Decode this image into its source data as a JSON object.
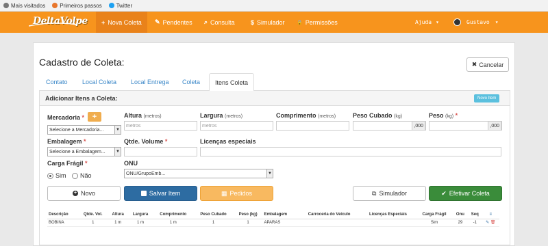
{
  "bookmarks": [
    {
      "label": "Mais visitados",
      "icon": "gear-icon"
    },
    {
      "label": "Primeiros passos",
      "icon": "firefox-icon"
    },
    {
      "label": "Twitter",
      "icon": "twitter-icon"
    }
  ],
  "navbar": {
    "brand": "DeltaVolpe",
    "items": [
      {
        "label": "Nova Coleta",
        "icon": "plus-icon",
        "glyph": "+"
      },
      {
        "label": "Pendentes",
        "icon": "edit-icon",
        "glyph": "✎"
      },
      {
        "label": "Consulta",
        "icon": "search-icon",
        "glyph": "⌕"
      },
      {
        "label": "Simulador",
        "icon": "dollar-icon",
        "glyph": "$"
      },
      {
        "label": "Permissões",
        "icon": "lock-icon",
        "glyph": "🔒"
      }
    ],
    "help_label": "Ajuda",
    "user_name": "Gustavo",
    "accent": "#f7941d"
  },
  "page": {
    "title": "Cadastro de Coleta:",
    "cancel_label": "Cancelar",
    "tabs": [
      {
        "label": "Contato"
      },
      {
        "label": "Local Coleta"
      },
      {
        "label": "Local Entrega"
      },
      {
        "label": "Coleta"
      },
      {
        "label": "Itens Coleta"
      }
    ]
  },
  "panel": {
    "title": "Adicionar Itens a Coleta:",
    "new_item_label": "Novo Item"
  },
  "form": {
    "mercadoria": {
      "label": "Mercadoria",
      "value": "Selecione a Mercadoria..."
    },
    "altura": {
      "label": "Altura",
      "unit": "(metros)",
      "placeholder": "metros"
    },
    "largura": {
      "label": "Largura",
      "unit": "(metros)",
      "placeholder": "metros"
    },
    "comprimento": {
      "label": "Comprimento",
      "unit": "(metros)",
      "value": ""
    },
    "peso_cubado": {
      "label": "Peso Cubado",
      "unit": "(kg)",
      "suffix": ",000"
    },
    "peso": {
      "label": "Peso",
      "unit": "(kg)",
      "suffix": ",000"
    },
    "embalagem": {
      "label": "Embalagem",
      "value": "Selecione a Embalagem..."
    },
    "qtde_volume": {
      "label": "Qtde. Volume",
      "value": ""
    },
    "licencas": {
      "label": "Licenças especiais",
      "value": ""
    },
    "carga_fragil": {
      "label": "Carga Frágil",
      "options": [
        "Sim",
        "Não"
      ],
      "selected": "Sim"
    },
    "onu": {
      "label": "ONU",
      "value": "ONU/GrupoEmb..."
    },
    "required_mark": "*"
  },
  "buttons": {
    "novo": "Novo",
    "salvar": "Salvar Item",
    "pedidos": "Pedidos",
    "simulador": "Simulador",
    "efetivar": "Efetivar Coleta"
  },
  "table": {
    "headers": [
      "Descrição",
      "Qtde. Vol.",
      "Altura",
      "Largura",
      "Comprimento",
      "Peso Cubado",
      "Peso (kg)",
      "Embalagem",
      "Carroceria do Veículo",
      "Licenças Especiais",
      "Carga Frágil",
      "Onu",
      "Seq",
      "≡"
    ],
    "rows": [
      [
        "BOBINA",
        "1",
        "1 m",
        "1 m",
        "1 m",
        "1",
        "1",
        "APARAS",
        "",
        "",
        "Sim",
        "29",
        "-1"
      ]
    ]
  }
}
